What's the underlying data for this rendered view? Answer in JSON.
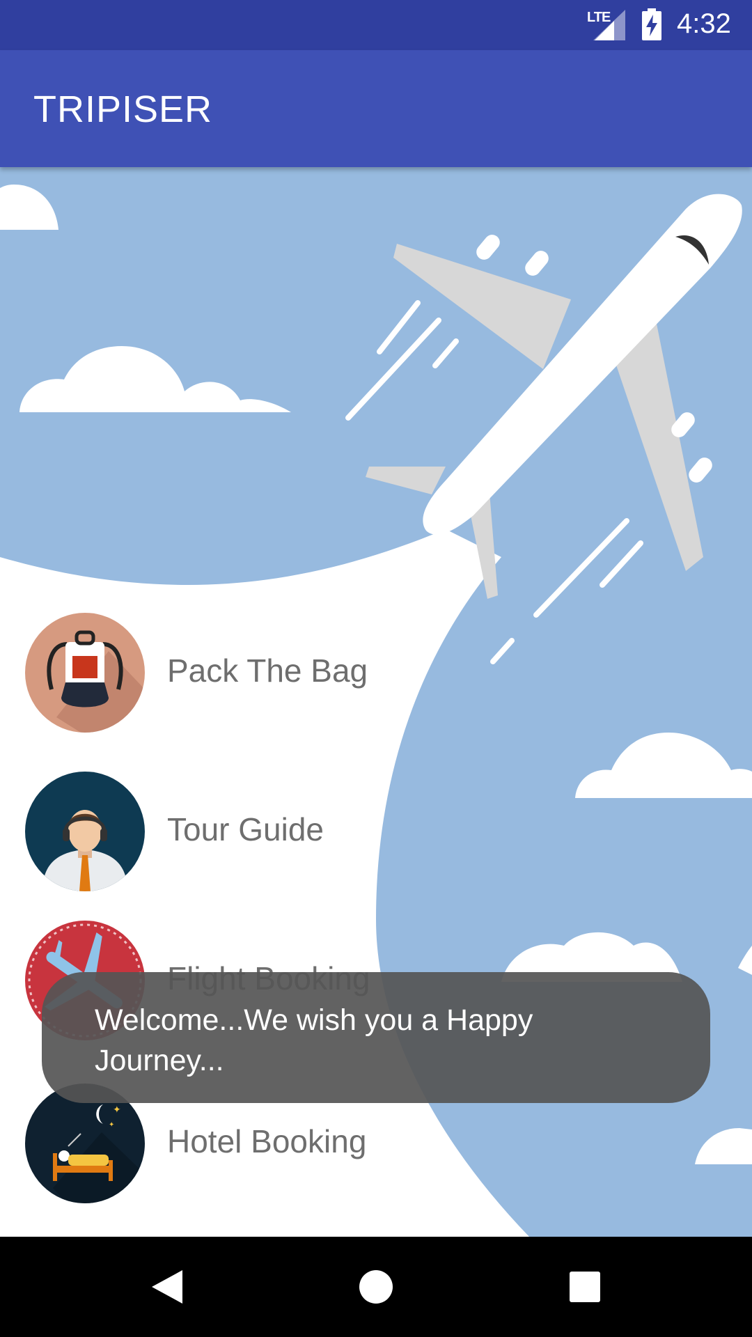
{
  "status_bar": {
    "network": "LTE",
    "time": "4:32"
  },
  "app_bar": {
    "title": "TRIPISER"
  },
  "menu": {
    "items": [
      {
        "label": "Pack The Bag",
        "icon": "backpack-icon"
      },
      {
        "label": "Tour Guide",
        "icon": "tour-guide-avatar-icon"
      },
      {
        "label": "Flight Booking",
        "icon": "airplane-icon"
      },
      {
        "label": "Hotel Booking",
        "icon": "bed-icon"
      }
    ]
  },
  "toast": {
    "message": "Welcome...We wish you a Happy Journey..."
  },
  "nav_bar": {
    "buttons": [
      "back-icon",
      "home-icon",
      "recents-icon"
    ]
  },
  "colors": {
    "status_bar": "#303F9F",
    "app_bar": "#3F51B5",
    "sky": "#97BADF",
    "toast": "#555555"
  }
}
